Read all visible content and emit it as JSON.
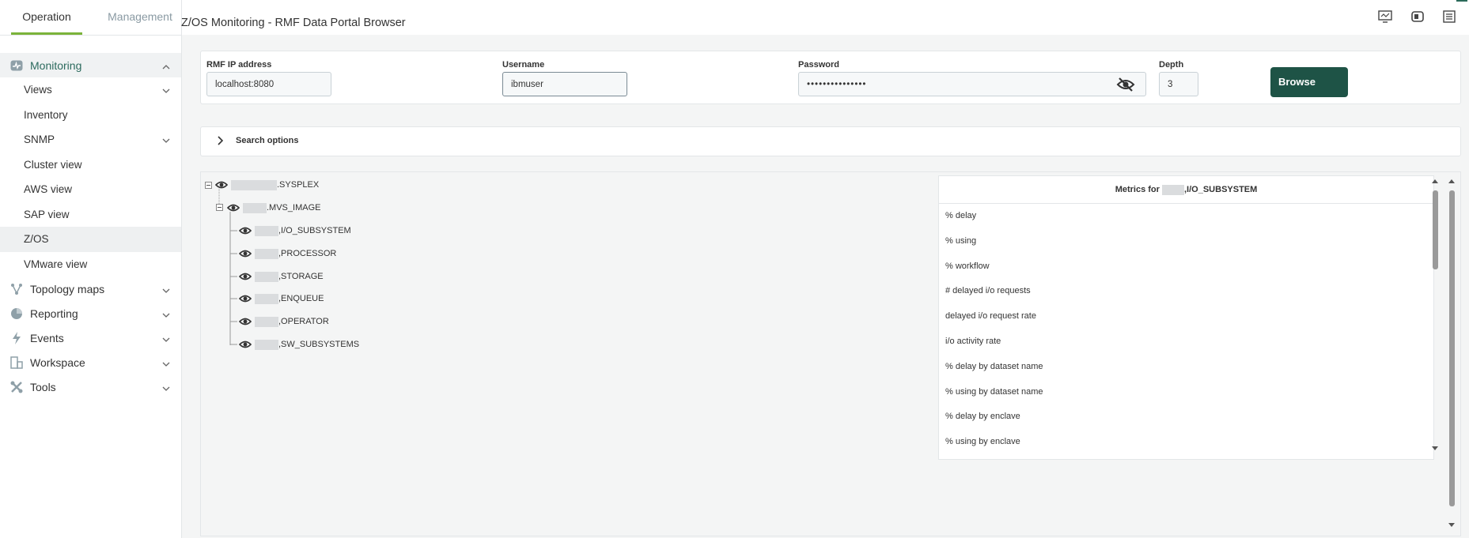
{
  "sidebar": {
    "tabs": [
      {
        "label": "Operation"
      },
      {
        "label": "Management"
      }
    ],
    "sections": [
      {
        "label": "Monitoring"
      },
      {
        "label": "Topology maps"
      },
      {
        "label": "Reporting"
      },
      {
        "label": "Events"
      },
      {
        "label": "Workspace"
      },
      {
        "label": "Tools"
      }
    ],
    "monitoring_items": [
      {
        "label": "Views"
      },
      {
        "label": "Inventory"
      },
      {
        "label": "SNMP"
      },
      {
        "label": "Cluster view"
      },
      {
        "label": "AWS view"
      },
      {
        "label": "SAP view"
      },
      {
        "label": "Z/OS"
      },
      {
        "label": "VMware view"
      }
    ]
  },
  "header": {
    "title": "Z/OS Monitoring - RMF Data Portal Browser"
  },
  "form": {
    "ip_label": "RMF IP address",
    "ip_value": "localhost:8080",
    "user_label": "Username",
    "user_value": "ibmuser",
    "pass_label": "Password",
    "pass_value": "•••••••••••••••",
    "depth_label": "Depth",
    "depth_value": "3",
    "browse_label": "Browse"
  },
  "search_options": {
    "label": "Search options"
  },
  "tree": {
    "root": ".SYSPLEX",
    "image": ".MVS_IMAGE",
    "children": [
      {
        "label": ",I/O_SUBSYSTEM"
      },
      {
        "label": ",PROCESSOR"
      },
      {
        "label": ",STORAGE"
      },
      {
        "label": ",ENQUEUE"
      },
      {
        "label": ",OPERATOR"
      },
      {
        "label": ",SW_SUBSYSTEMS"
      }
    ]
  },
  "metrics": {
    "title_prefix": "Metrics for",
    "title_suffix": ",I/O_SUBSYSTEM",
    "items": [
      {
        "label": "% delay"
      },
      {
        "label": "% using"
      },
      {
        "label": "% workflow"
      },
      {
        "label": "# delayed i/o requests"
      },
      {
        "label": "delayed i/o request rate"
      },
      {
        "label": "i/o activity rate"
      },
      {
        "label": "% delay by dataset name"
      },
      {
        "label": "% using by dataset name"
      },
      {
        "label": "% delay by enclave"
      },
      {
        "label": "% using by enclave"
      }
    ]
  },
  "colors": {
    "accent": "#1e5346",
    "tab_underline": "#7bb33a",
    "active_text": "#2c6b5e"
  }
}
